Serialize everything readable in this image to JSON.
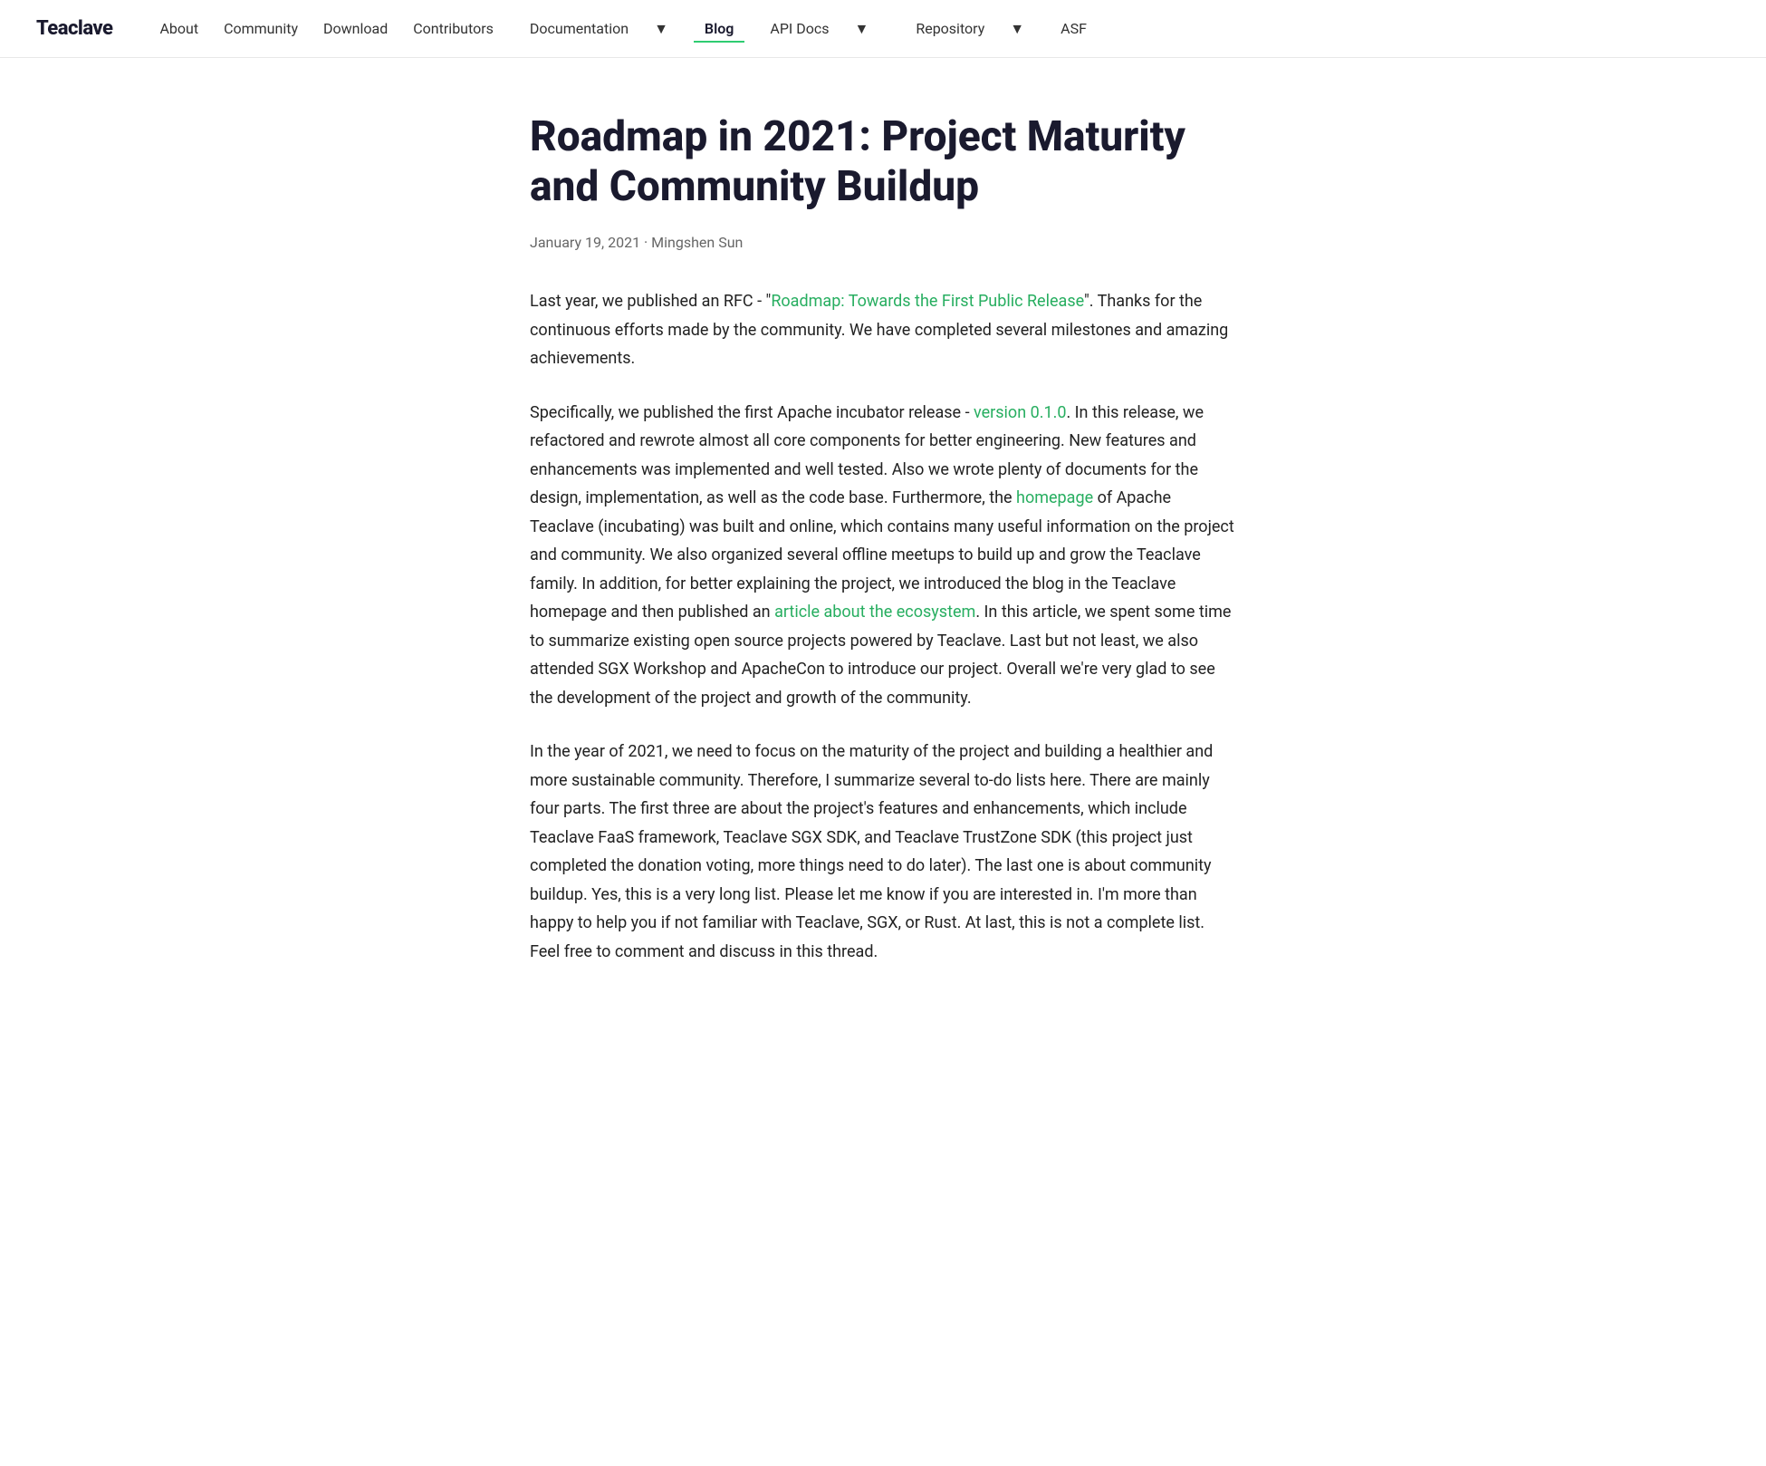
{
  "brand": "Teaclave",
  "nav": {
    "items": [
      {
        "label": "About",
        "active": false,
        "dropdown": false
      },
      {
        "label": "Community",
        "active": false,
        "dropdown": false
      },
      {
        "label": "Download",
        "active": false,
        "dropdown": false
      },
      {
        "label": "Contributors",
        "active": false,
        "dropdown": false
      },
      {
        "label": "Documentation",
        "active": false,
        "dropdown": true
      },
      {
        "label": "Blog",
        "active": true,
        "dropdown": false
      },
      {
        "label": "API Docs",
        "active": false,
        "dropdown": true
      },
      {
        "label": "Repository",
        "active": false,
        "dropdown": true
      },
      {
        "label": "ASF",
        "active": false,
        "dropdown": false
      }
    ]
  },
  "post": {
    "title": "Roadmap in 2021: Project Maturity and Community Buildup",
    "meta": "January 19, 2021 · Mingshen Sun",
    "paragraphs": [
      {
        "id": "p1",
        "text_before": "Last year, we published an RFC - \"",
        "link1_text": "Roadmap: Towards the First Public Release",
        "link1_href": "#",
        "text_after": "\". Thanks for the continuous efforts made by the community. We have completed several milestones and amazing achievements.",
        "link2_text": null,
        "link2_href": null,
        "text_mid": null,
        "text_end": null
      },
      {
        "id": "p2",
        "text_before": "Specifically, we published the first Apache incubator release - ",
        "link1_text": "version 0.1.0",
        "link1_href": "#",
        "text_mid": ". In this release, we refactored and rewrote almost all core components for better engineering. New features and enhancements was implemented and well tested. Also we wrote plenty of documents for the design, implementation, as well as the code base. Furthermore, the ",
        "link2_text": "homepage",
        "link2_href": "#",
        "text_after": " of Apache Teaclave (incubating) was built and online, which contains many useful information on the project and community. We also organized several offline meetups to build up and grow the Teaclave family. In addition, for better explaining the project, we introduced the blog in the Teaclave homepage and then published an ",
        "link3_text": "article about the ecosystem",
        "link3_href": "#",
        "text_end": ". In this article, we spent some time to summarize existing open source projects powered by Teaclave. Last but not least, we also attended SGX Workshop and ApacheCon to introduce our project. Overall we're very glad to see the development of the project and growth of the community."
      },
      {
        "id": "p3",
        "text_before": "In the year of 2021, we need to focus on the maturity of the project and building a healthier and more sustainable community. Therefore, I summarize several to-do lists here. There are mainly four parts. The first three are about the project's features and enhancements, which include Teaclave FaaS framework, Teaclave SGX SDK, and Teaclave TrustZone SDK (this project just completed the donation voting, more things need to do later). The last one is about community buildup. Yes, this is a very long list. Please let me know if you are interested in. I'm more than happy to help you if not familiar with Teaclave, SGX, or Rust. At last, this is not a complete list. Feel free to comment and discuss in this thread.",
        "link1_text": null
      }
    ]
  },
  "colors": {
    "link": "#27ae60",
    "active_underline": "#2ecc71",
    "text_primary": "#1a1a2e",
    "text_meta": "#666666"
  }
}
